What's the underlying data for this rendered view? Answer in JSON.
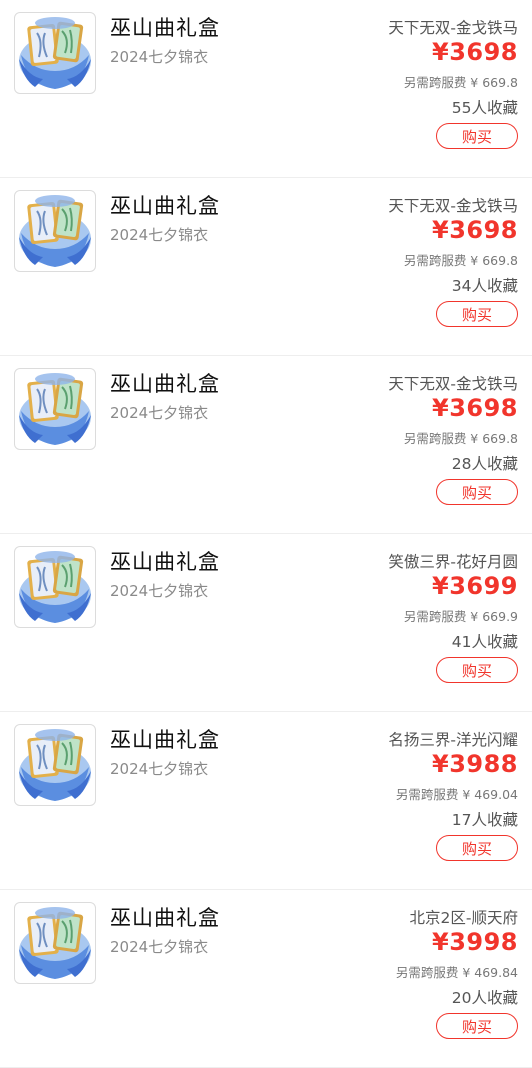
{
  "items": [
    {
      "title": "巫山曲礼盒",
      "subtitle": "2024七夕锦衣",
      "server": "天下无双-金戈铁马",
      "price": "¥3698",
      "fee": "另需跨服费 ¥ 669.8",
      "favorites": "55人收藏",
      "buy_label": "购买"
    },
    {
      "title": "巫山曲礼盒",
      "subtitle": "2024七夕锦衣",
      "server": "天下无双-金戈铁马",
      "price": "¥3698",
      "fee": "另需跨服费 ¥ 669.8",
      "favorites": "34人收藏",
      "buy_label": "购买"
    },
    {
      "title": "巫山曲礼盒",
      "subtitle": "2024七夕锦衣",
      "server": "天下无双-金戈铁马",
      "price": "¥3698",
      "fee": "另需跨服费 ¥ 669.8",
      "favorites": "28人收藏",
      "buy_label": "购买"
    },
    {
      "title": "巫山曲礼盒",
      "subtitle": "2024七夕锦衣",
      "server": "笑傲三界-花好月圆",
      "price": "¥3699",
      "fee": "另需跨服费 ¥ 669.9",
      "favorites": "41人收藏",
      "buy_label": "购买"
    },
    {
      "title": "巫山曲礼盒",
      "subtitle": "2024七夕锦衣",
      "server": "名扬三界-洋光闪耀",
      "price": "¥3988",
      "fee": "另需跨服费 ¥ 469.04",
      "favorites": "17人收藏",
      "buy_label": "购买"
    },
    {
      "title": "巫山曲礼盒",
      "subtitle": "2024七夕锦衣",
      "server": "北京2区-顺天府",
      "price": "¥3998",
      "fee": "另需跨服费 ¥ 469.84",
      "favorites": "20人收藏",
      "buy_label": "购买"
    }
  ],
  "colors": {
    "accent": "#f1352c",
    "divider": "#eeeeee",
    "secondary_text": "#8a8a8a"
  },
  "icons": {
    "product_thumbnail": "gift-box-icon"
  }
}
